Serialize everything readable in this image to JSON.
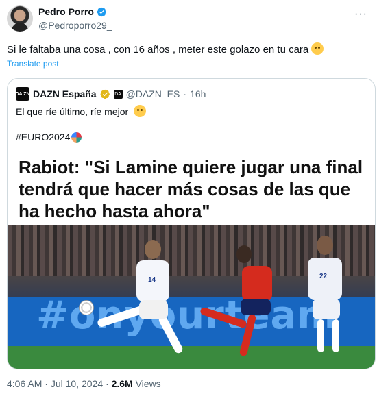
{
  "author": {
    "name": "Pedro Porro",
    "handle": "@Pedroporro29_"
  },
  "post": {
    "text": "Si le faltaba una cosa , con 16 años , meter este golazo en tu cara",
    "translate_label": "Translate post"
  },
  "quoted": {
    "avatar_text": "DA ZN",
    "name": "DAZN España",
    "square_badge_text": "DA",
    "handle": "@DAZN_ES",
    "separator": "·",
    "time": "16h",
    "text_line1": "El que ríe último, ríe mejor",
    "text_line2": "#EURO2024",
    "media": {
      "headline": "Rabiot: \"Si Lamine quiere jugar una final tendrá que hacer más cosas de las que ha hecho hasta ahora\"",
      "board_text": "#onyourteam",
      "jersey_numbers": [
        "14",
        "22"
      ]
    }
  },
  "meta": {
    "time": "4:06 AM",
    "dot": "·",
    "date": "Jul 10, 2024",
    "views_count": "2.6M",
    "views_label": "Views"
  },
  "colors": {
    "link": "#1d9bf0",
    "verified": "#1d9bf0",
    "gold_badge": "#e2b719",
    "muted": "#536471",
    "border": "#cfd9de"
  },
  "icons": {
    "verified": "verified-badge-icon",
    "more": "more-dots-icon",
    "emoji": "smiling-face-with-hearts-emoji",
    "quote_emoji": "smiling-face-emoji",
    "euro_ball": "soccer-ball-emoji"
  }
}
